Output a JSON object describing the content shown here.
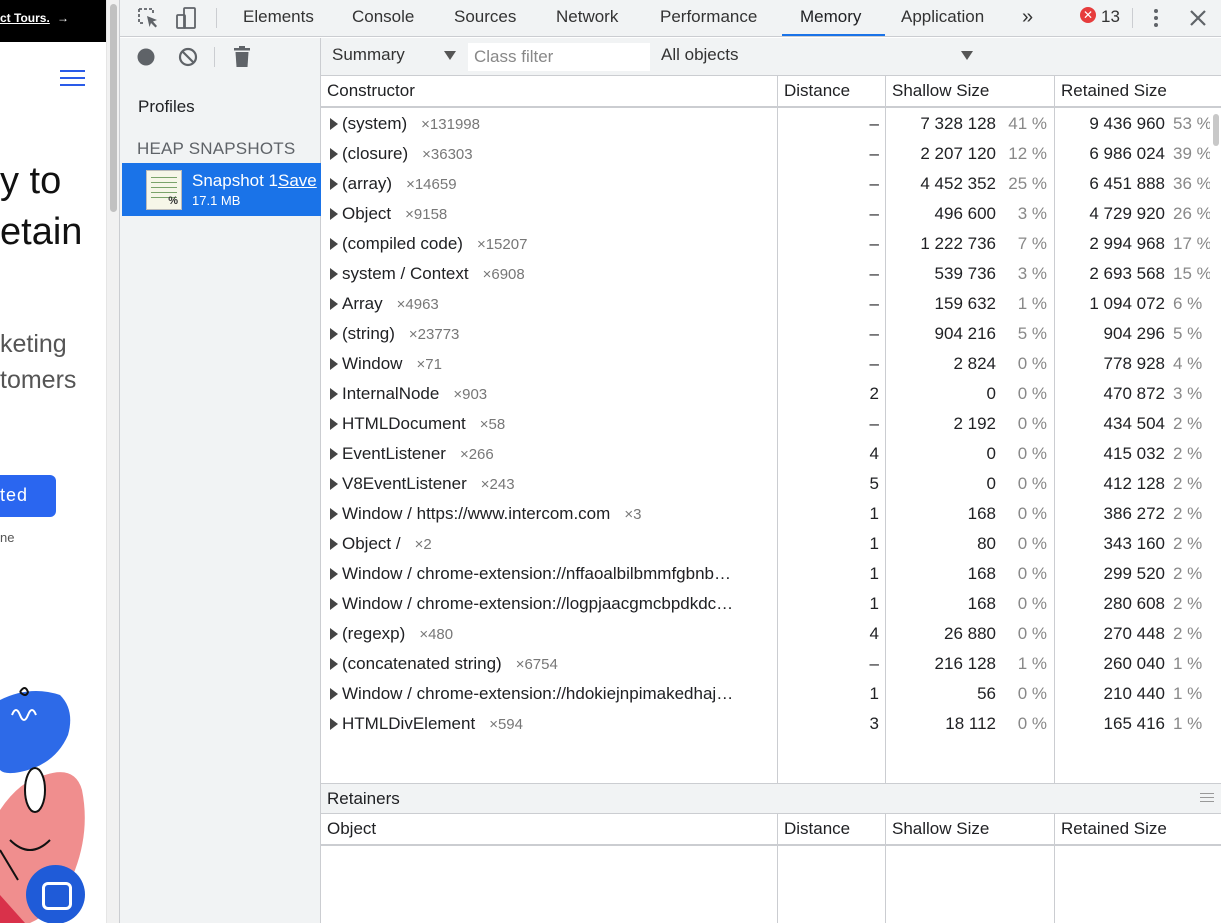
{
  "page": {
    "topbar_link": "ct Tours.",
    "topbar_arrow": "→",
    "headline_1": "y to",
    "headline_2": "etain",
    "subtext_1": "keting",
    "subtext_2": "tomers",
    "cta_label": "ted",
    "small_text": "ne"
  },
  "tabs": {
    "elements": "Elements",
    "console": "Console",
    "sources": "Sources",
    "network": "Network",
    "performance": "Performance",
    "memory": "Memory",
    "application": "Application",
    "more": "»",
    "error_count": "13",
    "error_badge": "✕"
  },
  "sidebar": {
    "profiles_title": "Profiles",
    "heap_label": "HEAP SNAPSHOTS",
    "snapshot_name": "Snapshot 1",
    "snapshot_save": "Save",
    "snapshot_size": "17.1 MB"
  },
  "toolbar": {
    "view": "Summary",
    "class_filter_placeholder": "Class filter",
    "objects": "All objects"
  },
  "headers": {
    "constructor": "Constructor",
    "object": "Object",
    "distance": "Distance",
    "shallow": "Shallow Size",
    "retained": "Retained Size",
    "retainers": "Retainers"
  },
  "rows": [
    {
      "name": "(system)",
      "count": "×131998",
      "distance": "–",
      "shallow": "7 328 128",
      "shallow_pct": "41 %",
      "retained": "9 436 960",
      "retained_pct": "53 %"
    },
    {
      "name": "(closure)",
      "count": "×36303",
      "distance": "–",
      "shallow": "2 207 120",
      "shallow_pct": "12 %",
      "retained": "6 986 024",
      "retained_pct": "39 %"
    },
    {
      "name": "(array)",
      "count": "×14659",
      "distance": "–",
      "shallow": "4 452 352",
      "shallow_pct": "25 %",
      "retained": "6 451 888",
      "retained_pct": "36 %"
    },
    {
      "name": "Object",
      "count": "×9158",
      "distance": "–",
      "shallow": "496 600",
      "shallow_pct": "3 %",
      "retained": "4 729 920",
      "retained_pct": "26 %"
    },
    {
      "name": "(compiled code)",
      "count": "×15207",
      "distance": "–",
      "shallow": "1 222 736",
      "shallow_pct": "7 %",
      "retained": "2 994 968",
      "retained_pct": "17 %"
    },
    {
      "name": "system / Context",
      "count": "×6908",
      "distance": "–",
      "shallow": "539 736",
      "shallow_pct": "3 %",
      "retained": "2 693 568",
      "retained_pct": "15 %"
    },
    {
      "name": "Array",
      "count": "×4963",
      "distance": "–",
      "shallow": "159 632",
      "shallow_pct": "1 %",
      "retained": "1 094 072",
      "retained_pct": "6 %"
    },
    {
      "name": "(string)",
      "count": "×23773",
      "distance": "–",
      "shallow": "904 216",
      "shallow_pct": "5 %",
      "retained": "904 296",
      "retained_pct": "5 %"
    },
    {
      "name": "Window",
      "count": "×71",
      "distance": "–",
      "shallow": "2 824",
      "shallow_pct": "0 %",
      "retained": "778 928",
      "retained_pct": "4 %"
    },
    {
      "name": "InternalNode",
      "count": "×903",
      "distance": "2",
      "shallow": "0",
      "shallow_pct": "0 %",
      "retained": "470 872",
      "retained_pct": "3 %"
    },
    {
      "name": "HTMLDocument",
      "count": "×58",
      "distance": "–",
      "shallow": "2 192",
      "shallow_pct": "0 %",
      "retained": "434 504",
      "retained_pct": "2 %"
    },
    {
      "name": "EventListener",
      "count": "×266",
      "distance": "4",
      "shallow": "0",
      "shallow_pct": "0 %",
      "retained": "415 032",
      "retained_pct": "2 %"
    },
    {
      "name": "V8EventListener",
      "count": "×243",
      "distance": "5",
      "shallow": "0",
      "shallow_pct": "0 %",
      "retained": "412 128",
      "retained_pct": "2 %"
    },
    {
      "name": "Window / https://www.intercom.com",
      "count": "×3",
      "distance": "1",
      "shallow": "168",
      "shallow_pct": "0 %",
      "retained": "386 272",
      "retained_pct": "2 %"
    },
    {
      "name": "Object /",
      "count": "×2",
      "distance": "1",
      "shallow": "80",
      "shallow_pct": "0 %",
      "retained": "343 160",
      "retained_pct": "2 %"
    },
    {
      "name": "Window / chrome-extension://nffaoalbilbmmfgbnb…",
      "count": "",
      "distance": "1",
      "shallow": "168",
      "shallow_pct": "0 %",
      "retained": "299 520",
      "retained_pct": "2 %"
    },
    {
      "name": "Window / chrome-extension://logpjaacgmcbpdkdc…",
      "count": "",
      "distance": "1",
      "shallow": "168",
      "shallow_pct": "0 %",
      "retained": "280 608",
      "retained_pct": "2 %"
    },
    {
      "name": "(regexp)",
      "count": "×480",
      "distance": "4",
      "shallow": "26 880",
      "shallow_pct": "0 %",
      "retained": "270 448",
      "retained_pct": "2 %"
    },
    {
      "name": "(concatenated string)",
      "count": "×6754",
      "distance": "–",
      "shallow": "216 128",
      "shallow_pct": "1 %",
      "retained": "260 040",
      "retained_pct": "1 %"
    },
    {
      "name": "Window / chrome-extension://hdokiejnpimakedhaj…",
      "count": "",
      "distance": "1",
      "shallow": "56",
      "shallow_pct": "0 %",
      "retained": "210 440",
      "retained_pct": "1 %"
    },
    {
      "name": "HTMLDivElement",
      "count": "×594",
      "distance": "3",
      "shallow": "18 112",
      "shallow_pct": "0 %",
      "retained": "165 416",
      "retained_pct": "1 %"
    }
  ],
  "colors": {
    "accent": "#1a73e8",
    "panel_bg": "#f1f3f4",
    "border": "#cbcdd1",
    "error": "#e63c3c"
  }
}
